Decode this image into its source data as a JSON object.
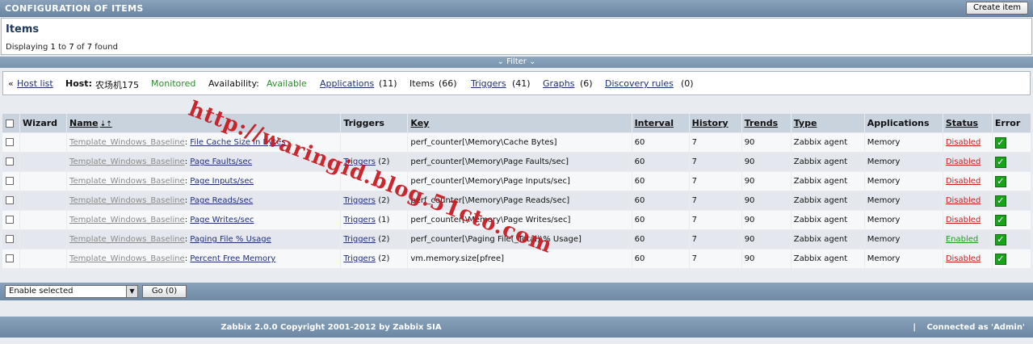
{
  "header": {
    "title": "CONFIGURATION OF ITEMS",
    "create_button": "Create item"
  },
  "items_box": {
    "title": "Items",
    "displaying_prefix": "Displaying",
    "from": "1",
    "to_word": "to",
    "to": "7",
    "of_word": "of",
    "total": "7",
    "found_word": "found"
  },
  "filter": {
    "label": "Filter",
    "icon": "chevron-down-icon"
  },
  "nav": {
    "back_symbol": "«",
    "host_list": "Host list",
    "host_label": "Host:",
    "host_name": "农场机175",
    "monitored": "Monitored",
    "availability_label": "Availability:",
    "availability_value": "Available",
    "applications": "Applications",
    "applications_count": "(11)",
    "items": "Items",
    "items_count": "(66)",
    "triggers": "Triggers",
    "triggers_count": "(41)",
    "graphs": "Graphs",
    "graphs_count": "(6)",
    "discovery": "Discovery rules",
    "discovery_count": "(0)"
  },
  "table": {
    "headers": {
      "wizard": "Wizard",
      "name": "Name",
      "triggers": "Triggers",
      "key": "Key",
      "interval": "Interval",
      "history": "History",
      "trends": "Trends",
      "type": "Type",
      "applications": "Applications",
      "status": "Status",
      "error": "Error"
    },
    "rows": [
      {
        "template": "Template_Windows_Baseline",
        "name": "File Cache Size in Bytes",
        "triggers": "",
        "triggers_count": "",
        "key": "perf_counter[\\Memory\\Cache Bytes]",
        "interval": "60",
        "history": "7",
        "trends": "90",
        "type": "Zabbix agent",
        "applications": "Memory",
        "status": "Disabled"
      },
      {
        "template": "Template_Windows_Baseline",
        "name": "Page Faults/sec",
        "triggers": "Triggers",
        "triggers_count": "(2)",
        "key": "perf_counter[\\Memory\\Page Faults/sec]",
        "interval": "60",
        "history": "7",
        "trends": "90",
        "type": "Zabbix agent",
        "applications": "Memory",
        "status": "Disabled"
      },
      {
        "template": "Template_Windows_Baseline",
        "name": "Page Inputs/sec",
        "triggers": "",
        "triggers_count": "",
        "key": "perf_counter[\\Memory\\Page Inputs/sec]",
        "interval": "60",
        "history": "7",
        "trends": "90",
        "type": "Zabbix agent",
        "applications": "Memory",
        "status": "Disabled"
      },
      {
        "template": "Template_Windows_Baseline",
        "name": "Page Reads/sec",
        "triggers": "Triggers",
        "triggers_count": "(2)",
        "key": "perf_counter[\\Memory\\Page Reads/sec]",
        "interval": "60",
        "history": "7",
        "trends": "90",
        "type": "Zabbix agent",
        "applications": "Memory",
        "status": "Disabled"
      },
      {
        "template": "Template_Windows_Baseline",
        "name": "Page Writes/sec",
        "triggers": "Triggers",
        "triggers_count": "(1)",
        "key": "perf_counter[\\Memory\\Page Writes/sec]",
        "interval": "60",
        "history": "7",
        "trends": "90",
        "type": "Zabbix agent",
        "applications": "Memory",
        "status": "Disabled"
      },
      {
        "template": "Template_Windows_Baseline",
        "name": "Paging File % Usage",
        "triggers": "Triggers",
        "triggers_count": "(2)",
        "key": "perf_counter[\\Paging File(_Total)\\% Usage]",
        "interval": "60",
        "history": "7",
        "trends": "90",
        "type": "Zabbix agent",
        "applications": "Memory",
        "status": "Enabled"
      },
      {
        "template": "Template_Windows_Baseline",
        "name": "Percent Free Memory",
        "triggers": "Triggers",
        "triggers_count": "(2)",
        "key": "vm.memory.size[pfree]",
        "interval": "60",
        "history": "7",
        "trends": "90",
        "type": "Zabbix agent",
        "applications": "Memory",
        "status": "Disabled"
      }
    ]
  },
  "actions": {
    "selected_action": "Enable selected",
    "go_button": "Go (0)"
  },
  "footer": {
    "copyright": "Zabbix 2.0.0 Copyright 2001-2012 by Zabbix SIA",
    "separator": "|",
    "connected": "Connected as 'Admin'"
  },
  "watermark": "http://waringid.blog.51cto.com",
  "colors": {
    "header_blue": "#7893ad",
    "status_disabled": "#c62020",
    "status_enabled": "#1f9a1f",
    "error_ok": "#1aa31a",
    "watermark": "#c8161d"
  }
}
